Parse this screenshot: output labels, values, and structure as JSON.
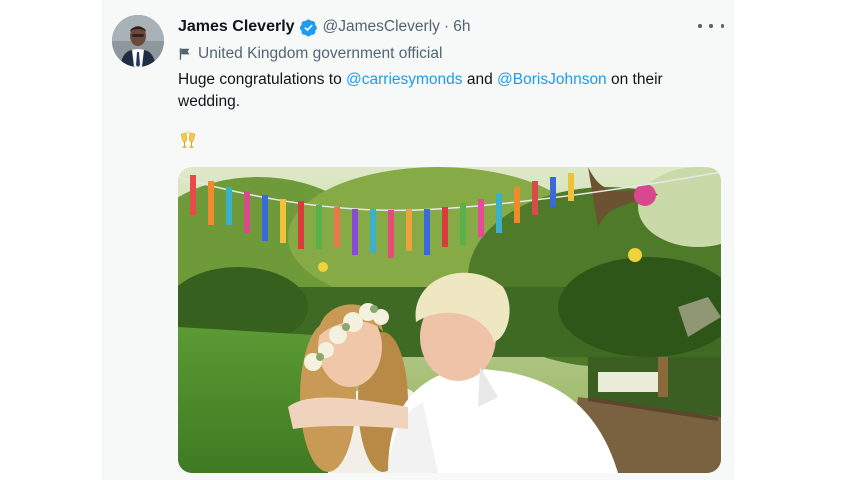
{
  "tweet": {
    "author_name": "James Cleverly",
    "handle": "@JamesCleverly",
    "separator": "·",
    "time": "6h",
    "affiliation": "United Kingdom government official",
    "text_before": "Huge congratulations to ",
    "mention_1": "@carriesymonds",
    "text_middle": " and ",
    "mention_2": "@BorisJohnson",
    "text_after": " on their wedding."
  },
  "colors": {
    "accent": "#1d9bf0",
    "secondary_text": "#536471",
    "primary_text": "#0f1419"
  },
  "icons": {
    "verified": "verified-badge-icon",
    "affiliation": "flag-icon",
    "more": "more-horizontal-icon",
    "emoji": "clinking-glasses-emoji"
  }
}
